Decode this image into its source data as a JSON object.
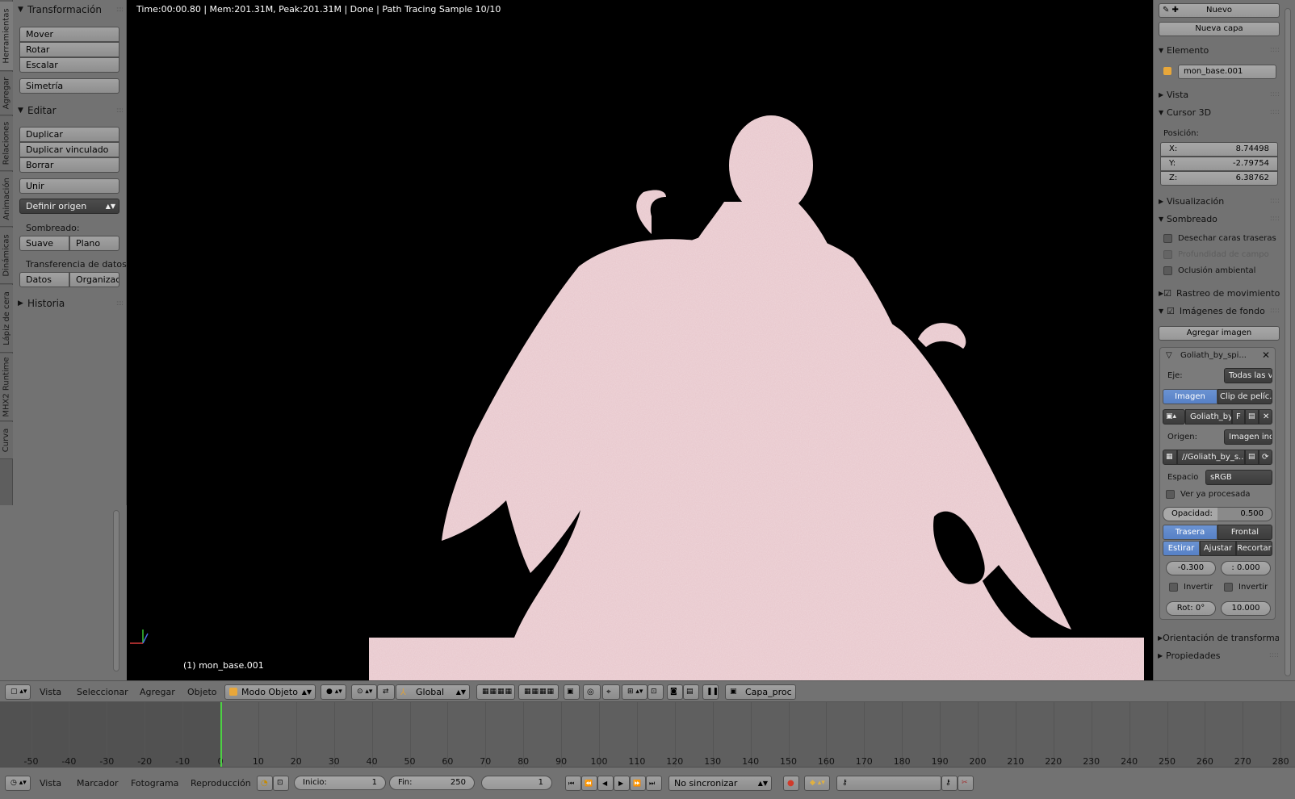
{
  "vertical_tabs": [
    "Herramientas",
    "Agregar",
    "Relaciones",
    "Animación",
    "Dinámicas",
    "Lápiz de cera",
    "MHX2 Runtime",
    "Curva"
  ],
  "tool_panel": {
    "transform": {
      "title": "Transformación",
      "items": [
        "Mover",
        "Rotar",
        "Escalar"
      ],
      "symmetry": "Simetría"
    },
    "edit": {
      "title": "Editar",
      "items": [
        "Duplicar",
        "Duplicar vinculado",
        "Borrar"
      ],
      "join": "Unir",
      "set_origin": "Definir origen"
    },
    "shading": {
      "label": "Sombreado:",
      "smooth": "Suave",
      "flat": "Plano"
    },
    "data_transfer": {
      "label": "Transferencia de datos:",
      "data": "Datos",
      "organize": "Organizaci"
    },
    "history": "Historia"
  },
  "viewport": {
    "render_info": "Time:00:00.80 | Mem:201.31M, Peak:201.31M | Done | Path Tracing Sample 10/10",
    "object_info": "(1) mon_base.001"
  },
  "right_panel": {
    "new_label": "Nuevo",
    "new_layer": "Nueva capa",
    "item": {
      "title": "Elemento",
      "name": "mon_base.001"
    },
    "view": "Vista",
    "cursor": {
      "title": "Cursor 3D",
      "position_label": "Posición:",
      "x_label": "X:",
      "x": "8.74498",
      "y_label": "Y:",
      "y": "-2.79754",
      "z_label": "Z:",
      "z": "6.38762"
    },
    "display": "Visualización",
    "shading": {
      "title": "Sombreado",
      "backface": "Desechar caras traseras",
      "dof": "Profundidad de campo",
      "ao": "Oclusión ambiental"
    },
    "motion_tracking": "Rastreo de movimiento",
    "background_images": {
      "title": "Imágenes de fondo",
      "add_image": "Agregar imagen",
      "image_name": "Goliath_by_spi...",
      "axis_label": "Eje:",
      "axis_value": "Todas las vist...",
      "tab_image": "Imagen",
      "tab_clip": "Clip de pelíc...",
      "image_short": "Goliath_by",
      "image_flag": "F",
      "source_label": "Origen:",
      "source_value": "Imagen indivi...",
      "filepath": "//Goliath_by_s...",
      "space_label": "Espacio",
      "space_value": "sRGB",
      "view_processed": "Ver ya procesada",
      "opacity_label": "Opacidad:",
      "opacity_value": "0.500",
      "back": "Trasera",
      "front": "Frontal",
      "stretch": "Estirar",
      "fit": "Ajustar",
      "crop": "Recortar",
      "offset_x": "-0.300",
      "offset_y": ": 0.000",
      "flip_x": "Invertir",
      "flip_y": "Invertir",
      "rotation": "Rot: 0°",
      "size": "10.000"
    },
    "transform_orientation": "Orientación de transformaci",
    "properties": "Propiedades"
  },
  "header": {
    "menus": [
      "Vista",
      "Seleccionar",
      "Agregar",
      "Objeto"
    ],
    "mode": "Modo Objeto",
    "orientation": "Global",
    "render_layer": "Capa_proc"
  },
  "timeline": {
    "ticks": [
      -50,
      -40,
      -30,
      -20,
      -10,
      0,
      10,
      20,
      30,
      40,
      50,
      60,
      70,
      80,
      90,
      100,
      110,
      120,
      130,
      140,
      150,
      160,
      170,
      180,
      190,
      200,
      210,
      220,
      230,
      240,
      250,
      260,
      270,
      280
    ],
    "current_frame": 0
  },
  "bottom_bar": {
    "menus": [
      "Vista",
      "Marcador",
      "Fotograma",
      "Reproducción"
    ],
    "start_label": "Inicio:",
    "start": "1",
    "end_label": "Fin:",
    "end": "250",
    "frame": "1",
    "sync": "No sincronizar"
  }
}
